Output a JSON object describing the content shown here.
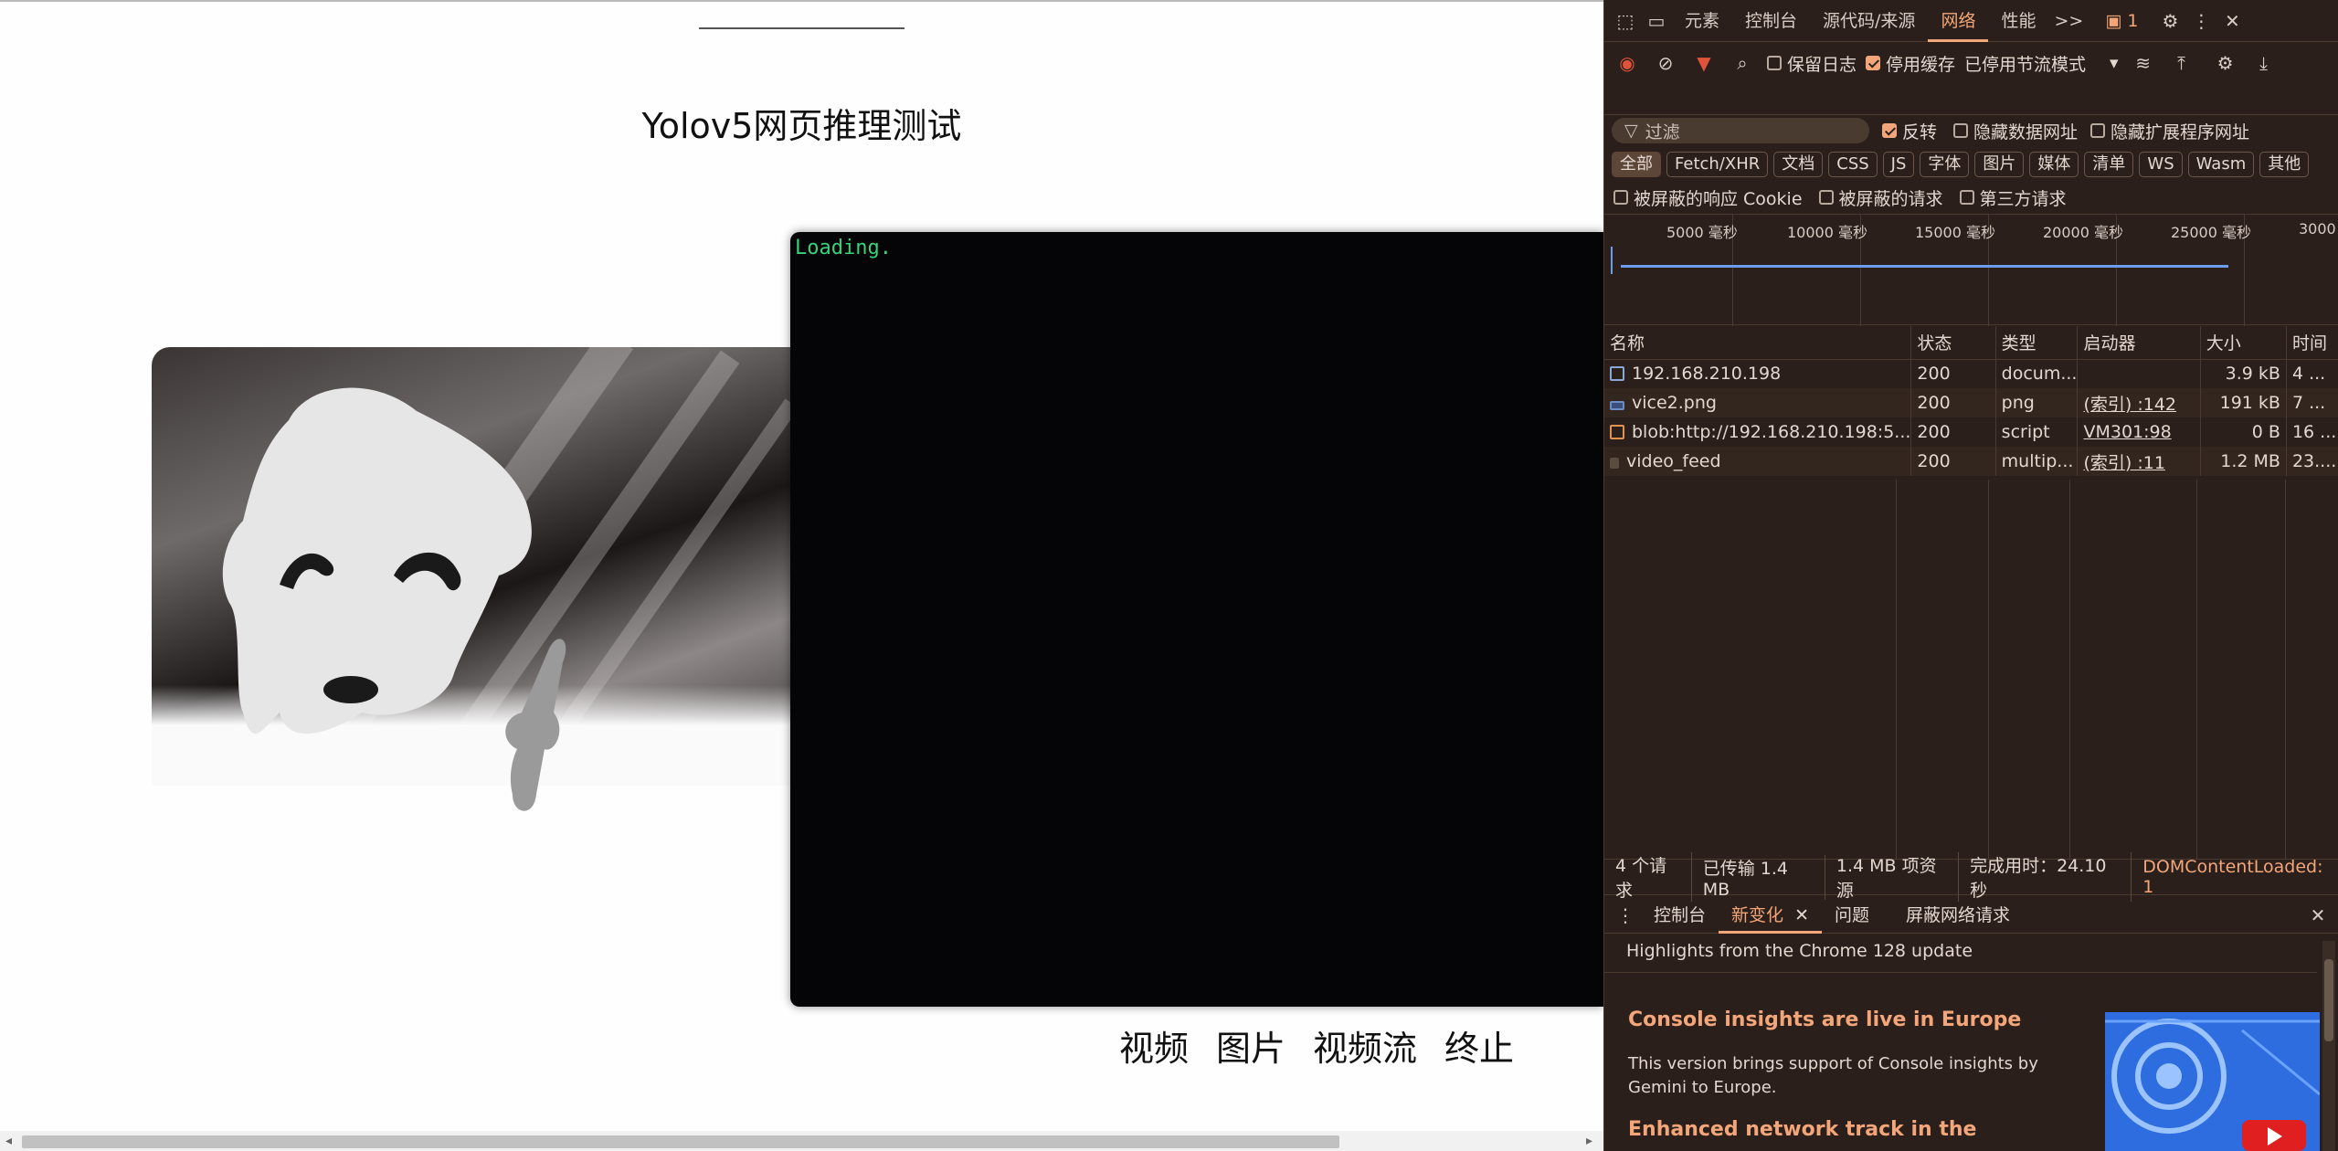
{
  "page": {
    "title": "Yolov5网页推理测试",
    "loading_text": "Loading.",
    "buttons": [
      "视频",
      "图片",
      "视频流",
      "终止"
    ]
  },
  "devtools": {
    "main_tabs": [
      "元素",
      "控制台",
      "源代码/来源",
      "网络",
      "性能"
    ],
    "active_tab": "网络",
    "more_tabs_label": ">>",
    "issues_count": "1",
    "toolbar": {
      "preserve_log": "保留日志",
      "disable_cache": "停用缓存",
      "throttle": "已停用节流模式"
    },
    "filter": {
      "placeholder": "过滤",
      "invert": "反转",
      "hide_data_urls": "隐藏数据网址",
      "hide_ext_urls": "隐藏扩展程序网址"
    },
    "type_chips": [
      "全部",
      "Fetch/XHR",
      "文档",
      "CSS",
      "JS",
      "字体",
      "图片",
      "媒体",
      "清单",
      "WS",
      "Wasm",
      "其他"
    ],
    "extra_filters": [
      "被屏蔽的响应 Cookie",
      "被屏蔽的请求",
      "第三方请求"
    ],
    "timeline_ticks": [
      "5000 毫秒",
      "10000 毫秒",
      "15000 毫秒",
      "20000 毫秒",
      "25000 毫秒",
      "3000"
    ],
    "columns": [
      "名称",
      "状态",
      "类型",
      "启动器",
      "大小",
      "时间"
    ],
    "requests": [
      {
        "name": "192.168.210.198",
        "status": "200",
        "type": "docum...",
        "initiator": "",
        "size": "3.9 kB",
        "time": "4 ..."
      },
      {
        "name": "vice2.png",
        "status": "200",
        "type": "png",
        "initiator": "(索引)  :142",
        "size": "191 kB",
        "time": "7 ..."
      },
      {
        "name": "blob:http://192.168.210.198:5...",
        "status": "200",
        "type": "script",
        "initiator": "VM301:98",
        "size": "0 B",
        "time": "16 ..."
      },
      {
        "name": "video_feed",
        "status": "200",
        "type": "multip...",
        "initiator": "(索引)  :11",
        "size": "1.2 MB",
        "time": "23...."
      }
    ],
    "status_bar": {
      "requests": "4 个请求",
      "transferred": "已传输 1.4 MB",
      "resources": "1.4 MB 项资源",
      "finish": "完成用时：24.10 秒",
      "dom": "DOMContentLoaded: 1"
    },
    "drawer_tabs": [
      "控制台",
      "新变化",
      "问题",
      "屏蔽网络请求"
    ],
    "drawer_active": "新变化",
    "whats_new": {
      "header": "Highlights from the Chrome 128 update",
      "h1": "Console insights are live in Europe",
      "p1": "This version brings support of Console insights by Gemini to Europe.",
      "h2": "Enhanced network track in the"
    }
  }
}
